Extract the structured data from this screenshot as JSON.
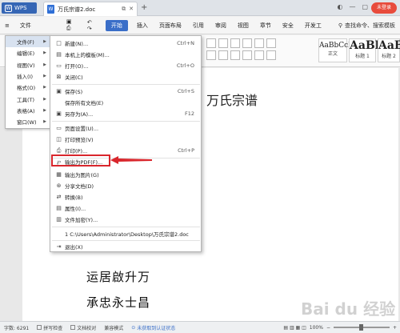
{
  "titlebar": {
    "app_label": "WPS",
    "doc_tab_title": "万氏宗谱2.doc",
    "login_label": "未登录",
    "colors": {
      "wps": "#3566b5",
      "login": "#e84b3c"
    }
  },
  "menubar": {
    "items": [
      "文件",
      "编辑",
      "视图",
      "插入",
      "格式",
      "工具",
      "表格",
      "窗口",
      "开始",
      "插入",
      "页面布局",
      "引用",
      "审阅",
      "视图",
      "章节",
      "安全",
      "开发工"
    ],
    "active_label": "开始",
    "search_label": "查找命令、搜索模板"
  },
  "ribbon": {
    "styles": [
      {
        "sample": "AaBbCcDd",
        "label": "正文"
      },
      {
        "sample": "AaBl",
        "label": "标题 1"
      },
      {
        "sample": "AaBl",
        "label": "标题 2"
      }
    ]
  },
  "left_menu": [
    {
      "label": "文件(F)",
      "selected": true
    },
    {
      "label": "编辑(E)",
      "selected": false
    },
    {
      "label": "视图(V)",
      "selected": false
    },
    {
      "label": "插入(I)",
      "selected": false
    },
    {
      "label": "格式(O)",
      "selected": false
    },
    {
      "label": "工具(T)",
      "selected": false
    },
    {
      "label": "表格(A)",
      "selected": false
    },
    {
      "label": "窗口(W)",
      "selected": false
    }
  ],
  "submenu": {
    "items": [
      {
        "icon": "new-doc-icon",
        "glyph": "□",
        "label": "新建(N)...",
        "shortcut": "Ctrl+N"
      },
      {
        "icon": "template-icon",
        "glyph": "▤",
        "label": "本机上的模板(M)...",
        "shortcut": ""
      },
      {
        "icon": "open-folder-icon",
        "glyph": "▭",
        "label": "打开(O)...",
        "shortcut": "Ctrl+O"
      },
      {
        "icon": "close-icon",
        "glyph": "⊠",
        "label": "关闭(C)",
        "shortcut": ""
      },
      {
        "icon": "save-icon",
        "glyph": "▣",
        "label": "保存(S)",
        "shortcut": "Ctrl+S"
      },
      {
        "icon": "",
        "glyph": "",
        "label": "保存所有文档(E)",
        "shortcut": ""
      },
      {
        "icon": "save-as-icon",
        "glyph": "▣",
        "label": "另存为(A)...",
        "shortcut": "F12"
      },
      {
        "icon": "page-setup-icon",
        "glyph": "▭",
        "label": "页面设置(U)...",
        "shortcut": ""
      },
      {
        "icon": "print-preview-icon",
        "glyph": "◫",
        "label": "打印预览(V)",
        "shortcut": ""
      },
      {
        "icon": "print-icon",
        "glyph": "⎙",
        "label": "打印(P)...",
        "shortcut": "Ctrl+P"
      },
      {
        "icon": "export-pdf-icon",
        "glyph": "℘",
        "label": "输出为PDF(F)...",
        "shortcut": ""
      },
      {
        "icon": "export-image-icon",
        "glyph": "▦",
        "label": "输出为图片(G)",
        "shortcut": ""
      },
      {
        "icon": "share-icon",
        "glyph": "⊛",
        "label": "分享文档(D)",
        "shortcut": ""
      },
      {
        "icon": "convert-icon",
        "glyph": "⇄",
        "label": "转换(B)",
        "shortcut": ""
      },
      {
        "icon": "properties-icon",
        "glyph": "▤",
        "label": "属性(I)...",
        "shortcut": ""
      },
      {
        "icon": "encrypt-icon",
        "glyph": "▥",
        "label": "文件加密(Y)...",
        "shortcut": ""
      },
      {
        "icon": "",
        "glyph": "",
        "label": "1 C:\\Users\\Administrator\\Desktop\\万氏宗谱2.doc",
        "shortcut": ""
      },
      {
        "icon": "exit-icon",
        "glyph": "⇥",
        "label": "退出(X)",
        "shortcut": ""
      }
    ],
    "highlight_color": "#d9262c"
  },
  "document": {
    "title": "万氏宗谱",
    "lines": [
      "运居啟升万",
      "承忠永士昌"
    ]
  },
  "statusbar": {
    "page_word": "字数: 6291",
    "spell": "拼写检查",
    "compare": "文档校对",
    "compat": "兼容模式",
    "cert_warning": "未获取到认证状态",
    "zoom": "100%"
  },
  "watermark": "Bai du 经验"
}
